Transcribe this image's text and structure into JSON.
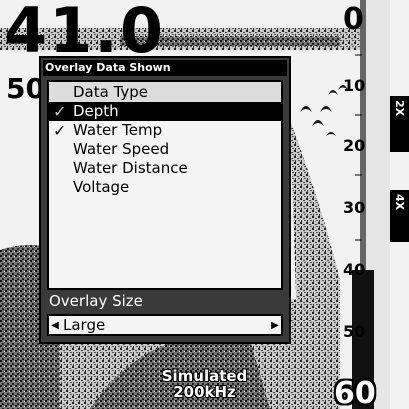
{
  "readout": {
    "depth_value": "41.0",
    "range_left": "50"
  },
  "depth_scale": {
    "top": "0",
    "ticks": [
      "10",
      "20",
      "30",
      "40",
      "50"
    ],
    "bottom": "60"
  },
  "zoom_tabs": {
    "tab_2x": "2X",
    "tab_4x": "4X"
  },
  "status": {
    "line1": "Simulated",
    "line2": "200kHz"
  },
  "dialog": {
    "title": "Overlay Data Shown",
    "list_header": "Data Type",
    "items": [
      {
        "label": "Depth",
        "checked": true,
        "selected": true
      },
      {
        "label": "Water Temp",
        "checked": true,
        "selected": false
      },
      {
        "label": "Water Speed",
        "checked": false,
        "selected": false
      },
      {
        "label": "Water Distance",
        "checked": false,
        "selected": false
      },
      {
        "label": "Voltage",
        "checked": false,
        "selected": false
      }
    ],
    "size_label": "Overlay Size",
    "size_value": "Large"
  },
  "icons": {
    "check": "check-icon",
    "left_arrow": "left-arrow-icon",
    "right_arrow": "right-arrow-icon"
  }
}
